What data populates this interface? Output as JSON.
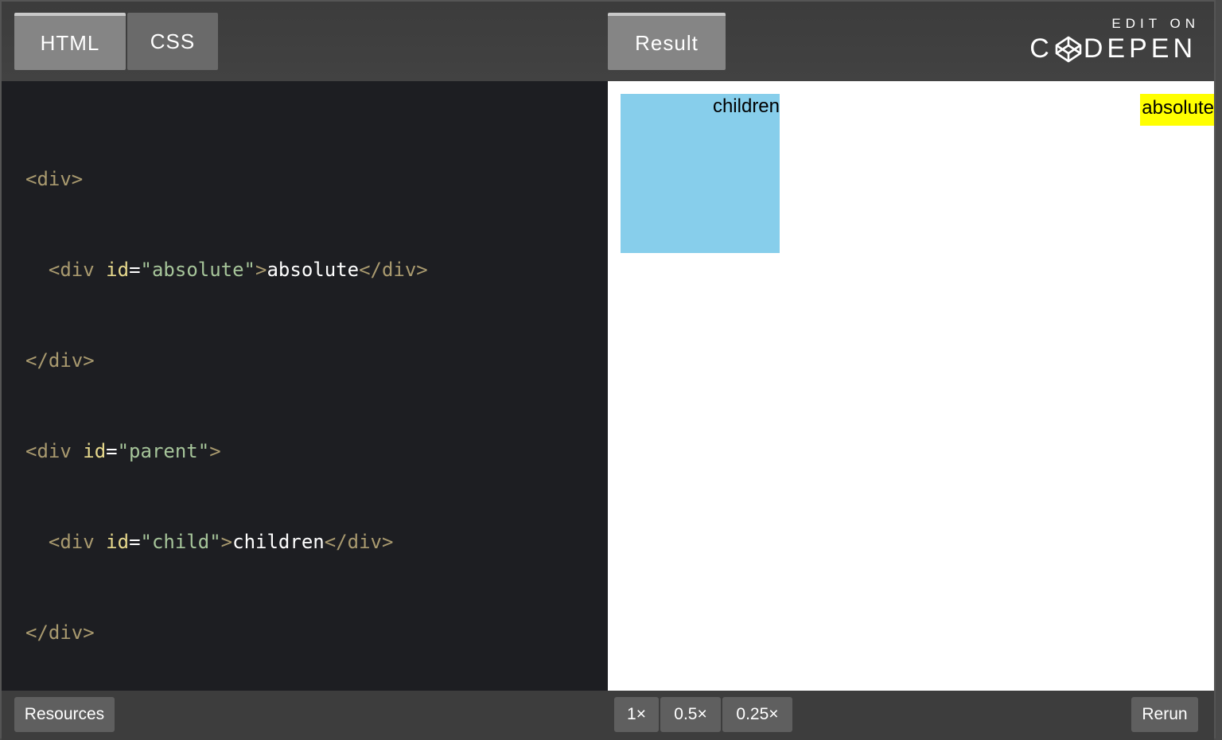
{
  "tabs": {
    "html": "HTML",
    "css": "CSS",
    "result": "Result"
  },
  "branding": {
    "edit_on": "EDIT ON",
    "codepen_left": "C",
    "codepen_right": "DEPEN"
  },
  "code_lines": [
    {
      "p1": "<div>"
    },
    {
      "p1": "  <div ",
      "attr": "id",
      "eq": "=",
      "str": "\"absolute\"",
      "p2": ">",
      "text": "absolute",
      "p3": "</div>"
    },
    {
      "p1": "</div>"
    },
    {
      "p1": "<div ",
      "attr": "id",
      "eq": "=",
      "str": "\"parent\"",
      "p2": ">"
    },
    {
      "p1": "  <div ",
      "attr": "id",
      "eq": "=",
      "str": "\"child\"",
      "p2": ">",
      "text": "children",
      "p3": "</div>"
    },
    {
      "p1": "</div>"
    }
  ],
  "preview": {
    "child_text": "children",
    "absolute_text": "absolute",
    "parent_color": "#87ceeb",
    "absolute_color": "#ffff00"
  },
  "bottom": {
    "resources": "Resources",
    "zoom_1x": "1×",
    "zoom_05x": "0.5×",
    "zoom_025x": "0.25×",
    "rerun": "Rerun"
  }
}
